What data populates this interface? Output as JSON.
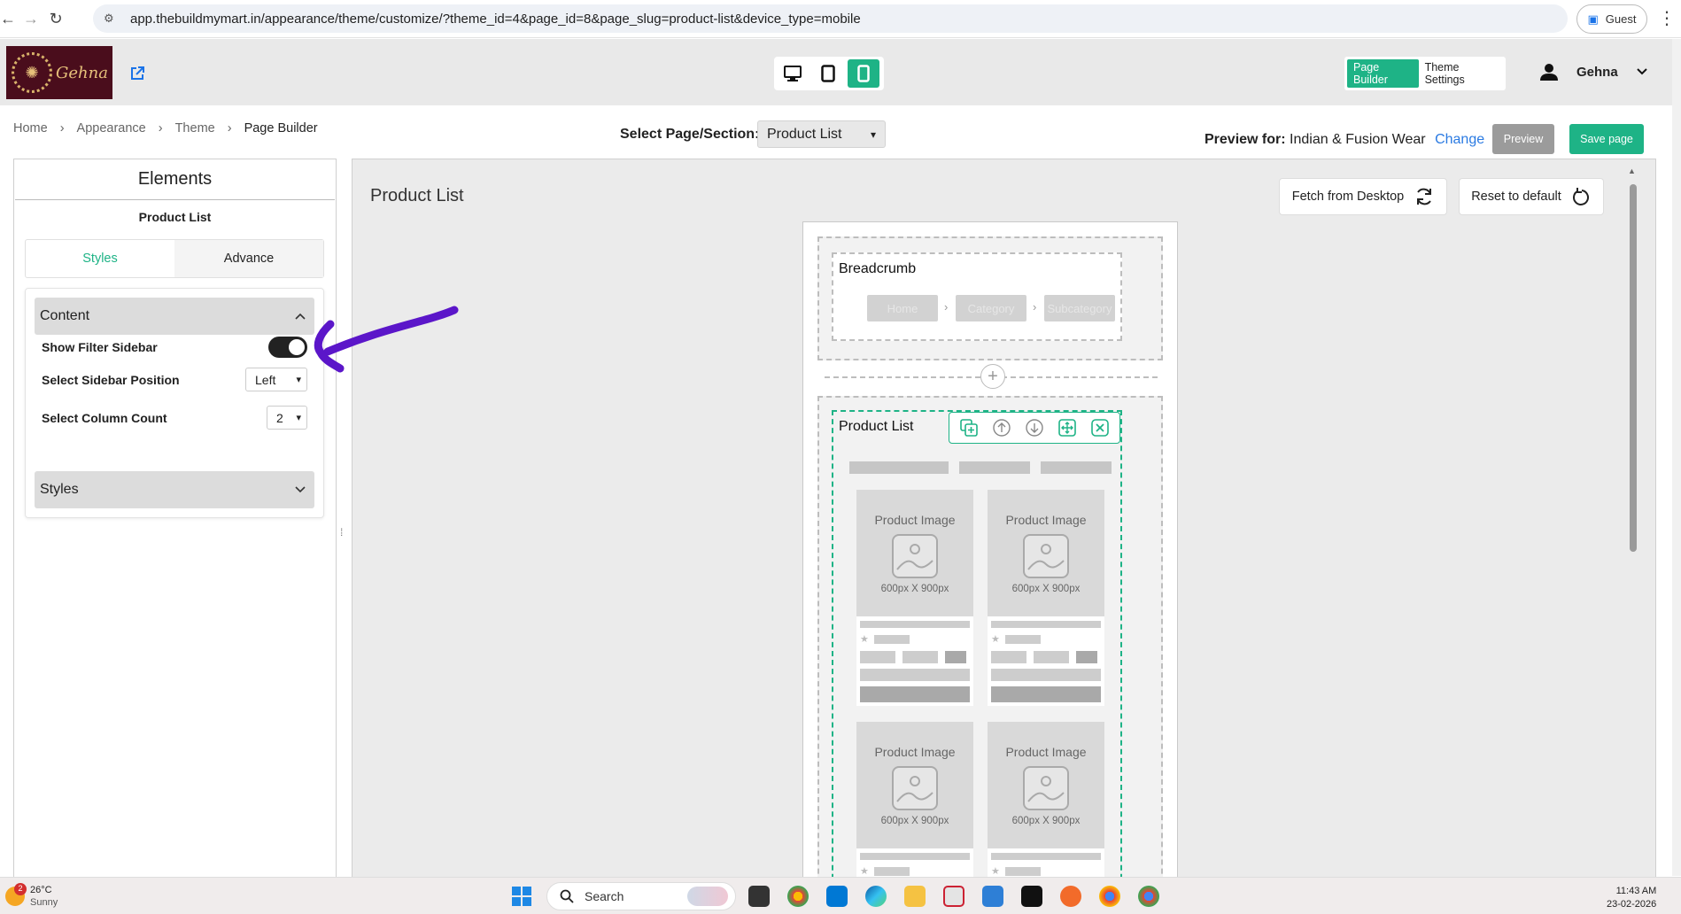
{
  "browser": {
    "url": "app.thebuildmymart.in/appearance/theme/customize/?theme_id=4&page_id=8&page_slug=product-list&device_type=mobile",
    "profile_label": "Guest"
  },
  "header": {
    "logo_text": "Gehna",
    "device_modes": [
      "desktop",
      "tablet",
      "mobile"
    ],
    "active_device": "mobile",
    "tabs": [
      "Page Builder",
      "Theme Settings"
    ],
    "user_name": "Gehna"
  },
  "breadcrumb": [
    "Home",
    "Appearance",
    "Theme",
    "Page Builder"
  ],
  "toolbar": {
    "select_label": "Select Page/Section:",
    "selected_page": "Product List",
    "preview_for_label": "Preview for:",
    "preview_for_value": "Indian & Fusion Wear",
    "change_label": "Change",
    "preview_label": "Preview",
    "save_label": "Save page"
  },
  "left_panel": {
    "title": "Elements",
    "subtitle": "Product List",
    "tabs": [
      "Styles",
      "Advance"
    ],
    "content_section": {
      "title": "Content",
      "show_filter_label": "Show Filter Sidebar",
      "show_filter_on": true,
      "sidebar_position_label": "Select Sidebar Position",
      "sidebar_position_value": "Left",
      "column_count_label": "Select Column Count",
      "column_count_value": "2"
    },
    "styles_section": {
      "title": "Styles"
    }
  },
  "canvas": {
    "title": "Product List",
    "fetch_label": "Fetch from Desktop",
    "reset_label": "Reset to default",
    "breadcrumb_block": {
      "title": "Breadcrumb",
      "items": [
        "Home",
        "Category",
        "Subcategory"
      ]
    },
    "product_list_block": {
      "title": "Product List",
      "card_image_label": "Product Image",
      "card_image_size": "600px X 900px"
    }
  },
  "taskbar": {
    "temperature": "26°C",
    "weather": "Sunny",
    "notifications": "2",
    "search_placeholder": "Search",
    "time": "11:43 AM",
    "date": "23-02-2026"
  },
  "colors": {
    "accent": "#1eb386",
    "annotation": "#5b16c9",
    "logo_bg": "#4a0d1c",
    "link": "#2a7ae2"
  }
}
